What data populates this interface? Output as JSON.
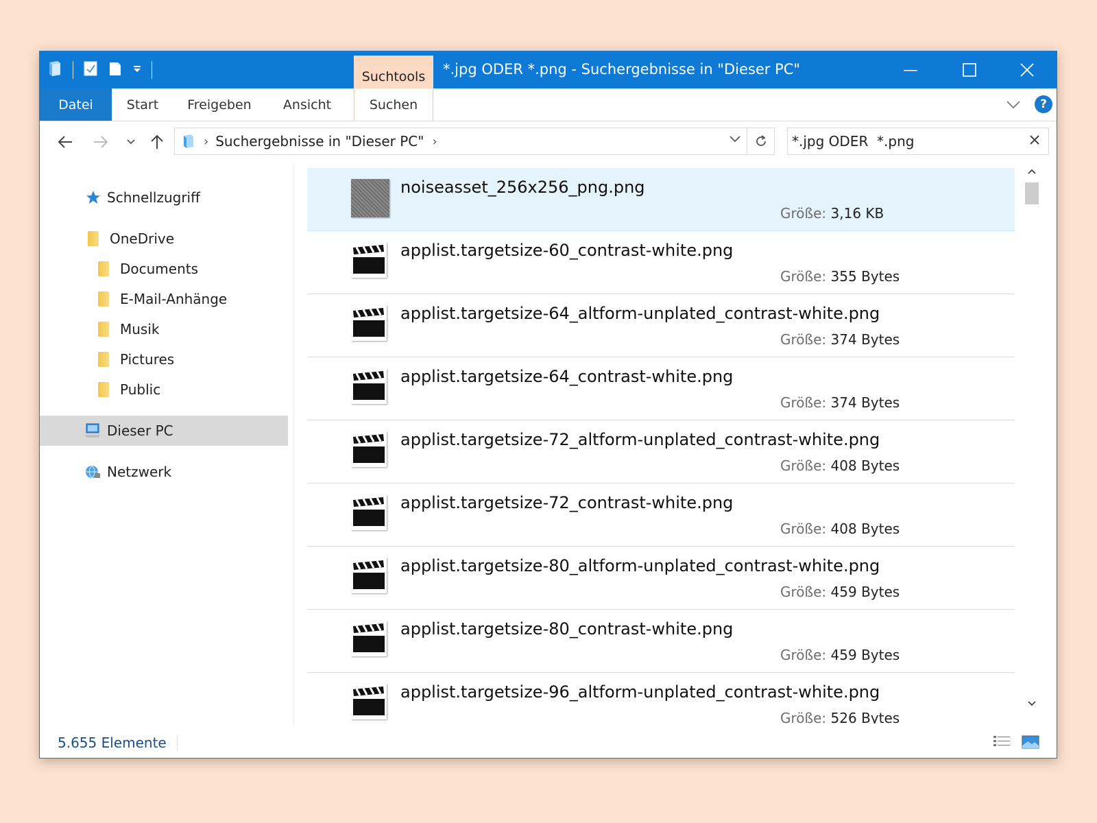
{
  "window": {
    "title": "*.jpg ODER  *.png - Suchergebnisse in \"Dieser PC\"",
    "context_tab": "Suchtools"
  },
  "ribbon": {
    "tabs": [
      "Datei",
      "Start",
      "Freigeben",
      "Ansicht",
      "Suchen"
    ],
    "help": "?"
  },
  "address": {
    "crumb": "Suchergebnisse in \"Dieser PC\"",
    "search_value": "*.jpg ODER  *.png"
  },
  "nav": {
    "items": [
      {
        "label": "Schnellzugriff",
        "icon": "star-icon"
      },
      {
        "label": "OneDrive",
        "icon": "folder-icon"
      },
      {
        "label": "Documents",
        "icon": "folder-icon"
      },
      {
        "label": "E-Mail-Anhänge",
        "icon": "folder-icon"
      },
      {
        "label": "Musik",
        "icon": "folder-icon"
      },
      {
        "label": "Pictures",
        "icon": "folder-icon"
      },
      {
        "label": "Public",
        "icon": "folder-icon"
      },
      {
        "label": "Dieser PC",
        "icon": "computer-icon"
      },
      {
        "label": "Netzwerk",
        "icon": "network-icon"
      }
    ]
  },
  "results": {
    "size_label": "Größe:",
    "files": [
      {
        "name": "noiseasset_256x256_png.png",
        "size": "3,16 KB",
        "thumb": "noise"
      },
      {
        "name": "applist.targetsize-60_contrast-white.png",
        "size": "355 Bytes",
        "thumb": "clapper"
      },
      {
        "name": "applist.targetsize-64_altform-unplated_contrast-white.png",
        "size": "374 Bytes",
        "thumb": "clapper"
      },
      {
        "name": "applist.targetsize-64_contrast-white.png",
        "size": "374 Bytes",
        "thumb": "clapper"
      },
      {
        "name": "applist.targetsize-72_altform-unplated_contrast-white.png",
        "size": "408 Bytes",
        "thumb": "clapper"
      },
      {
        "name": "applist.targetsize-72_contrast-white.png",
        "size": "408 Bytes",
        "thumb": "clapper"
      },
      {
        "name": "applist.targetsize-80_altform-unplated_contrast-white.png",
        "size": "459 Bytes",
        "thumb": "clapper"
      },
      {
        "name": "applist.targetsize-80_contrast-white.png",
        "size": "459 Bytes",
        "thumb": "clapper"
      },
      {
        "name": "applist.targetsize-96_altform-unplated_contrast-white.png",
        "size": "526 Bytes",
        "thumb": "clapper"
      }
    ]
  },
  "status": {
    "count": "5.655 Elemente"
  },
  "colors": {
    "titlebar": "#0f7ad6",
    "file_tab": "#1979ca",
    "context_tab": "#fbd9c3",
    "selection": "#e5f3fd",
    "background": "#fde1cf"
  }
}
